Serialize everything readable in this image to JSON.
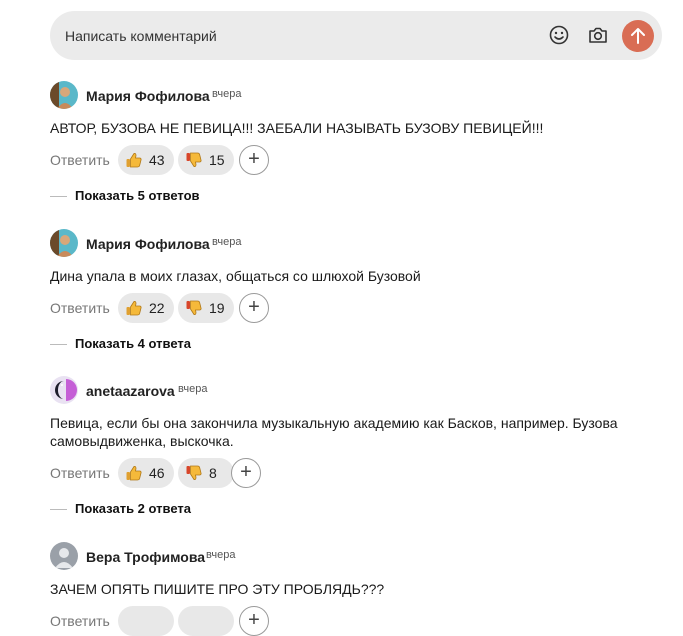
{
  "composer": {
    "placeholder": "Написать комментарий",
    "icons": [
      "smiley-icon",
      "camera-icon",
      "send-arrow-icon"
    ],
    "send_color": "#d96d54"
  },
  "comments": [
    {
      "author": "Мария Фофилова",
      "time": "вчера",
      "text": "АВТОР, БУЗОВА НЕ ПЕВИЦА!!! ЗАЕБАЛИ НАЗЫВАТЬ БУЗОВУ ПЕВИЦЕЙ!!!",
      "reply_label": "Ответить",
      "likes": "43",
      "dislikes": "15",
      "show_replies": "Показать 5 ответов"
    },
    {
      "author": "Мария Фофилова",
      "time": "вчера",
      "text": "Дина упала в моих глазах, общаться со шлюхой Бузовой",
      "reply_label": "Ответить",
      "likes": "22",
      "dislikes": "19",
      "show_replies": "Показать 4 ответа"
    },
    {
      "author": "anetaazarova",
      "time": "вчера",
      "text_line1": "Певица, если бы она закончила музыкальную академию как Басков, например. Бузова",
      "text_line2": "самовыдвиженка, выскочка.",
      "reply_label": "Ответить",
      "likes": "46",
      "dislikes": "8",
      "show_replies": "Показать 2 ответа"
    },
    {
      "author": "Вера Трофимова",
      "time": "вчера",
      "text": "ЗАЧЕМ ОПЯТЬ ПИШИТЕ ПРО ЭТУ ПРОБЛЯДЬ???",
      "reply_label": "Ответить"
    }
  ]
}
